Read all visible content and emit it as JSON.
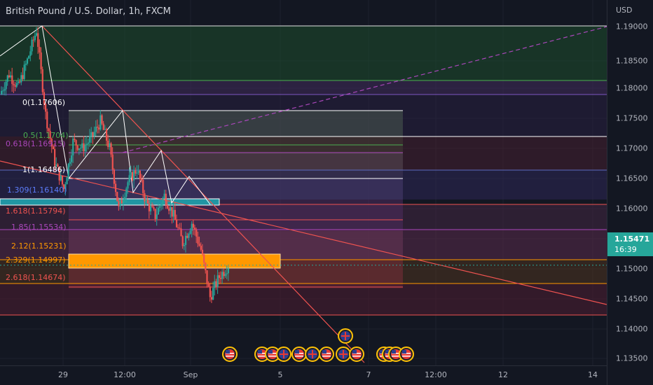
{
  "header": {
    "title": "British Pound / U.S. Dollar, 1h, FXCM"
  },
  "price_axis": {
    "currency": "USD",
    "ticks": [
      "1.19000",
      "1.18500",
      "1.18000",
      "1.17500",
      "1.17000",
      "1.16500",
      "1.16000",
      "1.15500",
      "1.15000",
      "1.14500",
      "1.14000",
      "1.13500"
    ],
    "current_price": "1.15471",
    "countdown": "16:39"
  },
  "time_axis": {
    "ticks": [
      "29",
      "12:00",
      "Sep",
      "5",
      "7",
      "12:00",
      "12",
      "14"
    ]
  },
  "fib_levels": [
    {
      "label": "0(1.17606)",
      "color": "#ffffff"
    },
    {
      "label": "0.5(1.1704)",
      "color": "#4caf50"
    },
    {
      "label": "0.618(1.16915)",
      "color": "#ab47bc"
    },
    {
      "label": "1(1.16486)",
      "color": "#ffffff"
    },
    {
      "label": "1.309(1.16140)",
      "color": "#5c7cfa"
    },
    {
      "label": "1.618(1.15794)",
      "color": "#ef5350"
    },
    {
      "label": "1.85(1.15534)",
      "color": "#ab47bc"
    },
    {
      "label": "2.12(1.15231)",
      "color": "#ff9800"
    },
    {
      "label": "2.329(1.14997)",
      "color": "#ff9800"
    },
    {
      "label": "2.618(1.14674)",
      "color": "#ef5350"
    }
  ],
  "colors": {
    "up": "#26a69a",
    "down": "#ef5350",
    "background": "#131722",
    "accent": "#ff9800"
  },
  "event_icons": [
    "uk-flag-icon",
    "us-flag-icon",
    "us-flag-icon",
    "us-flag-icon",
    "uk-flag-icon",
    "us-flag-icon",
    "uk-flag-icon",
    "us-flag-icon",
    "uk-flag-icon",
    "us-flag-icon",
    "us-flag-icon",
    "us-flag-icon",
    "us-flag-icon",
    "us-flag-icon"
  ],
  "chart_data": {
    "type": "candlestick",
    "symbol": "British Pound / U.S. Dollar",
    "interval": "1h",
    "ylim": [
      1.133,
      1.192
    ],
    "close_path": [
      [
        "2020-08-27 12:00",
        1.18
      ],
      [
        "2020-08-27 18:00",
        1.183
      ],
      [
        "2020-08-28 00:00",
        1.181
      ],
      [
        "2020-08-28 06:00",
        1.185
      ],
      [
        "2020-08-28 12:00",
        1.1895
      ],
      [
        "2020-08-28 15:00",
        1.177
      ],
      [
        "2020-08-28 21:00",
        1.17
      ],
      [
        "2020-08-29 06:00",
        1.166
      ],
      [
        "2020-08-29 12:00",
        1.173
      ],
      [
        "2020-08-29 18:00",
        1.172
      ],
      [
        "2020-08-30 00:00",
        1.1735
      ],
      [
        "2020-08-30 06:00",
        1.176
      ],
      [
        "2020-08-30 12:00",
        1.172
      ],
      [
        "2020-08-30 15:00",
        1.163
      ],
      [
        "2020-08-30 21:00",
        1.167
      ],
      [
        "2020-08-31 03:00",
        1.169
      ],
      [
        "2020-08-31 09:00",
        1.164
      ],
      [
        "2020-08-31 15:00",
        1.162
      ],
      [
        "2020-08-31 21:00",
        1.165
      ],
      [
        "2020-09-01 03:00",
        1.162
      ],
      [
        "2020-09-01 09:00",
        1.158
      ],
      [
        "2020-09-01 15:00",
        1.161
      ],
      [
        "2020-09-01 21:00",
        1.157
      ],
      [
        "2020-09-02 00:00",
        1.15
      ],
      [
        "2020-09-02 03:00",
        1.153
      ],
      [
        "2020-09-02 06:00",
        1.1547
      ]
    ]
  }
}
